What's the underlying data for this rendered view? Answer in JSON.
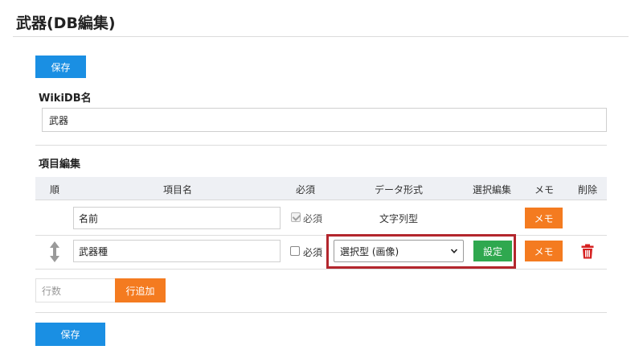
{
  "page": {
    "title": "武器(DB編集)"
  },
  "buttons": {
    "save_top": "保存",
    "save_bottom": "保存",
    "add_row": "行追加"
  },
  "wikidb": {
    "label": "WikiDB名",
    "value": "武器"
  },
  "items": {
    "section_label": "項目編集",
    "headers": {
      "order": "順",
      "name": "項目名",
      "required": "必須",
      "data_type": "データ形式",
      "choice_edit": "選択編集",
      "memo": "メモ",
      "delete": "削除"
    },
    "rows": [
      {
        "name": "名前",
        "required_label": "必須",
        "required_checked": true,
        "required_disabled": true,
        "data_type_text": "文字列型",
        "memo_label": "メモ"
      },
      {
        "name": "武器種",
        "required_label": "必須",
        "required_checked": false,
        "data_type_selected": "選択型 (画像)",
        "settings_label": "設定",
        "memo_label": "メモ"
      }
    ]
  },
  "row_count": {
    "placeholder": "行数"
  },
  "icons": {
    "sort_handle": "updown-arrow-icon",
    "delete": "trash-icon",
    "select_chevron": "chevron-down-icon"
  },
  "colors": {
    "primary_blue": "#1a8fe3",
    "memo_orange": "#f47b20",
    "settings_green": "#2fa84f",
    "delete_red": "#d62020",
    "highlight_red": "#b3262d"
  }
}
